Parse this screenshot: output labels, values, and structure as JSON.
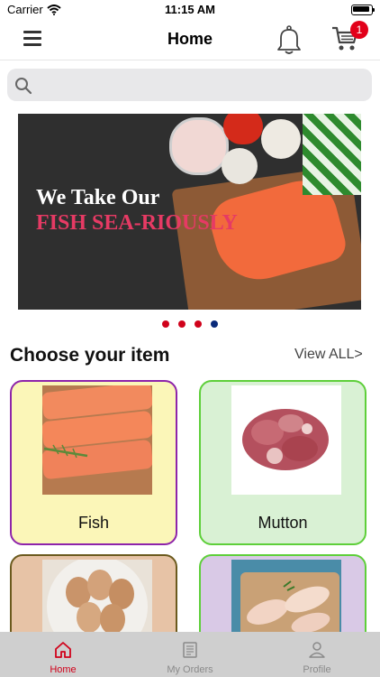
{
  "status": {
    "carrier": "Carrier",
    "time": "11:15 AM"
  },
  "header": {
    "title": "Home",
    "cart_count": "1"
  },
  "search": {
    "placeholder": "",
    "value": ""
  },
  "banner": {
    "line1": "We Take Our",
    "line2": "FISH SEA-RIOUSLY"
  },
  "carousel": {
    "count": 4,
    "active_index": 3,
    "colors": {
      "inactive": "#d0021b",
      "active": "#0a2a7a"
    }
  },
  "section": {
    "title": "Choose your item",
    "view_all": "View ALL>"
  },
  "categories": [
    {
      "name": "Fish",
      "bg": "#fbf6b8",
      "border": "#8e24aa"
    },
    {
      "name": "Mutton",
      "bg": "#d9f1d4",
      "border": "#5ecf3a"
    },
    {
      "name": "",
      "bg": "#e7c3a6",
      "border": "#6b5a1e"
    },
    {
      "name": "",
      "bg": "#d9c9e6",
      "border": "#5ecf3a"
    }
  ],
  "tabs": [
    {
      "label": "Home",
      "icon": "home-icon",
      "active": true
    },
    {
      "label": "My Orders",
      "icon": "orders-icon",
      "active": false
    },
    {
      "label": "Profile",
      "icon": "profile-icon",
      "active": false
    }
  ],
  "colors": {
    "accent_red": "#d0021b",
    "tab_inactive": "#8a8a8a",
    "tab_active": "#d0021b"
  }
}
